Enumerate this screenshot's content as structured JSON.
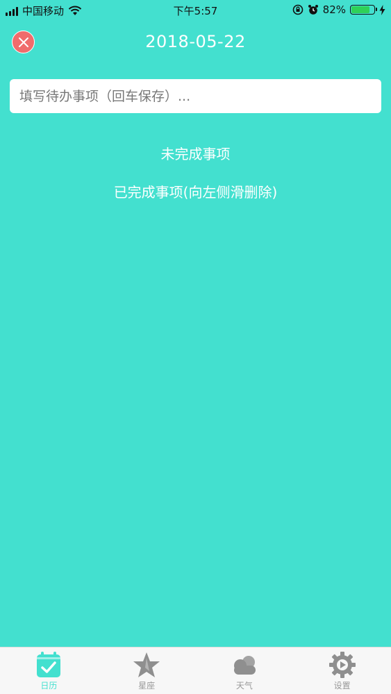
{
  "status_bar": {
    "carrier": "中国移动",
    "time": "下午5:57",
    "battery_percent": "82%",
    "battery_level": 0.82
  },
  "header": {
    "date": "2018-05-22"
  },
  "todo_input": {
    "placeholder": "填写待办事项（回车保存）..."
  },
  "sections": {
    "pending": "未完成事项",
    "completed": "已完成事项(向左侧滑删除)"
  },
  "tabs": [
    {
      "label": "日历",
      "icon": "calendar-icon",
      "active": true
    },
    {
      "label": "星座",
      "icon": "star-icon",
      "active": false
    },
    {
      "label": "天气",
      "icon": "cloud-icon",
      "active": false
    },
    {
      "label": "设置",
      "icon": "gear-icon",
      "active": false
    }
  ],
  "colors": {
    "background": "#43E0CF",
    "close_button": "#F06C6C",
    "tab_inactive": "#999999"
  }
}
